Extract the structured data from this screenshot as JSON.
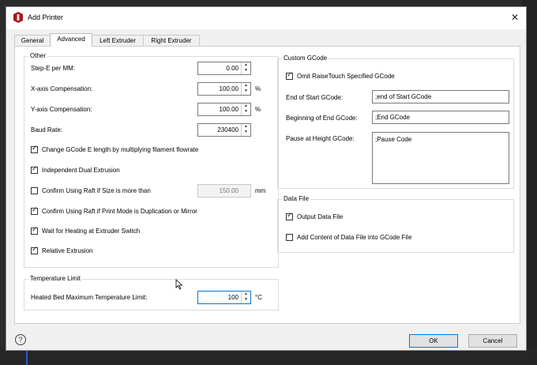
{
  "window": {
    "title": "Add Printer",
    "close_glyph": "✕",
    "accent": "#0078d7",
    "icon": "printer-logo-icon"
  },
  "tabs": [
    {
      "label": "General",
      "active": false
    },
    {
      "label": "Advanced",
      "active": true
    },
    {
      "label": "Left Extruder",
      "active": false
    },
    {
      "label": "Right Extruder",
      "active": false
    }
  ],
  "other": {
    "title": "Other",
    "step_e": {
      "label": "Step-E per MM:",
      "value": "0.00"
    },
    "x_comp": {
      "label": "X-axis Compensation:",
      "value": "100.00",
      "unit": "%"
    },
    "y_comp": {
      "label": "Y-axis Compensation:",
      "value": "100.00",
      "unit": "%"
    },
    "baud": {
      "label": "Baud Rate:",
      "value": "230400"
    },
    "checks": [
      {
        "label": "Change GCode E length by multiplying filament flowrate",
        "checked": true
      },
      {
        "label": "Independent Dual Extrusion",
        "checked": true
      },
      {
        "label": "Confirm Using Raft if Size is more than",
        "checked": false,
        "value": "150.00",
        "unit": "mm"
      },
      {
        "label": "Confirm Using Raft if Print Mode is Duplication or Mirror",
        "checked": true
      },
      {
        "label": "Wait for Heating at Extruder Switch",
        "checked": true
      },
      {
        "label": "Relative Extrusion",
        "checked": true
      }
    ]
  },
  "temp": {
    "title": "Temperature Limit",
    "label": "Heated Bed Maximum Temperature Limit:",
    "value": "100",
    "unit": "°C"
  },
  "gcode": {
    "title": "Custom GCode",
    "omit": {
      "label": "Omit RaiseTouch Specified GCode",
      "checked": true
    },
    "end_start": {
      "label": "End of Start GCode:",
      "value": ";end of Start GCode"
    },
    "begin_end": {
      "label": "Beginning of End GCode:",
      "value": ";End GCode"
    },
    "pause": {
      "label": "Pause at Height GCode:",
      "value": ";Pause Code"
    }
  },
  "datafile": {
    "title": "Data File",
    "output": {
      "label": "Output Data File",
      "checked": true
    },
    "add_content": {
      "label": "Add Content of Data File into GCode File",
      "checked": false
    }
  },
  "footer": {
    "help_glyph": "?",
    "ok_label": "OK",
    "cancel_label": "Cancel"
  },
  "spinner": {
    "up": "▲",
    "down": "▼"
  }
}
